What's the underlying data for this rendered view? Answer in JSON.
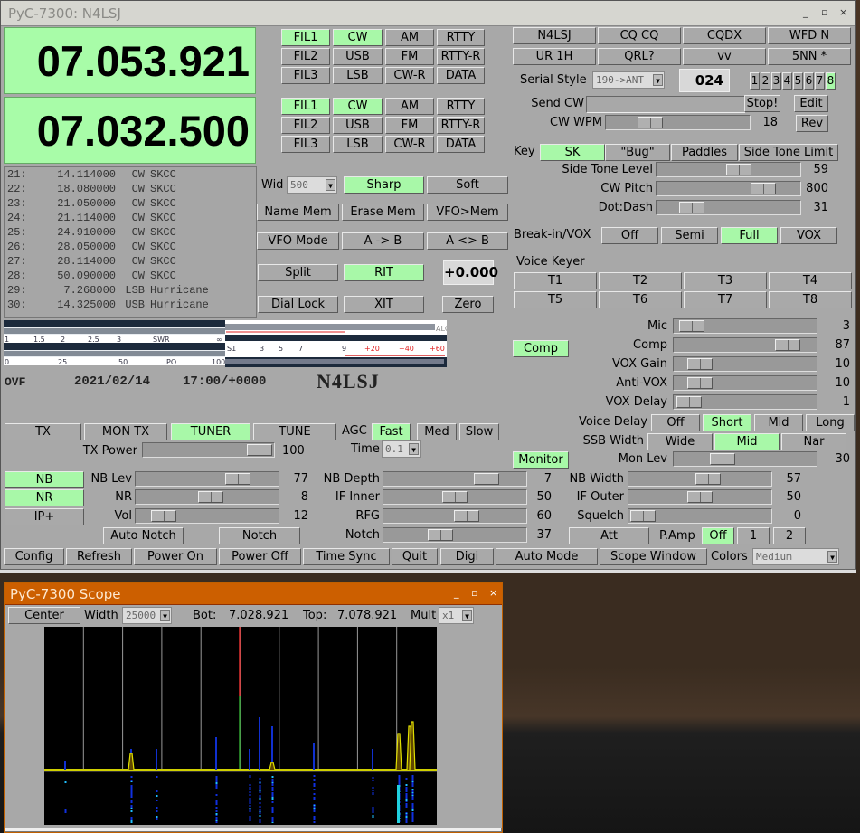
{
  "main_window": {
    "title": "PyC-7300: N4LSJ",
    "controls": {
      "minimize": "_",
      "maximize": "▫",
      "close": "×"
    },
    "vfo_a": "07.053.921",
    "vfo_b": "07.032.500",
    "mode_grid_a": [
      [
        "FIL1",
        "CW",
        "AM",
        "RTTY"
      ],
      [
        "FIL2",
        "USB",
        "FM",
        "RTTY-R"
      ],
      [
        "FIL3",
        "LSB",
        "CW-R",
        "DATA"
      ]
    ],
    "mode_grid_b": [
      [
        "FIL1",
        "CW",
        "AM",
        "RTTY"
      ],
      [
        "FIL2",
        "USB",
        "FM",
        "RTTY-R"
      ],
      [
        "FIL3",
        "LSB",
        "CW-R",
        "DATA"
      ]
    ],
    "active_modes": [
      "FIL1",
      "CW"
    ],
    "macros": [
      [
        "N4LSJ",
        "CQ CQ",
        "CQDX",
        "WFD N"
      ],
      [
        "UR 1H",
        "QRL?",
        "vv",
        "5NN *"
      ]
    ],
    "serial_style_label": "Serial Style",
    "serial_style_value": "190->ANT",
    "serial_number": "024",
    "memory_keys": [
      "1",
      "2",
      "3",
      "4",
      "5",
      "6",
      "7",
      "8"
    ],
    "memory_key_active": "8",
    "send_cw_label": "Send CW",
    "send_cw_value": "",
    "stop_label": "Stop!",
    "edit_label": "Edit",
    "cw_wpm_label": "CW WPM",
    "cw_wpm_value": "18",
    "cw_wpm_frac": 0.26,
    "rev_label": "Rev",
    "key_label": "Key",
    "key_options": [
      "SK",
      "\"Bug\"",
      "Paddles",
      "Side Tone Limit"
    ],
    "key_active": "SK",
    "side_tone_level": {
      "label": "Side Tone Level",
      "value": "59",
      "frac": 0.59
    },
    "cw_pitch": {
      "label": "CW Pitch",
      "value": "800",
      "frac": 0.8
    },
    "dot_dash": {
      "label": "Dot:Dash",
      "value": "31",
      "frac": 0.18
    },
    "breakin_label": "Break-in/VOX",
    "breakin_options": [
      "Off",
      "Semi",
      "Full",
      "VOX"
    ],
    "breakin_active": "Full",
    "voice_keyer_label": "Voice Keyer",
    "voice_keys": [
      "T1",
      "T2",
      "T3",
      "T4",
      "T5",
      "T6",
      "T7",
      "T8"
    ],
    "memory_list": [
      {
        "ch": "21:",
        "freq": "14.114000",
        "mode": "CW",
        "name": "SKCC"
      },
      {
        "ch": "22:",
        "freq": "18.080000",
        "mode": "CW",
        "name": "SKCC"
      },
      {
        "ch": "23:",
        "freq": "21.050000",
        "mode": "CW",
        "name": "SKCC"
      },
      {
        "ch": "24:",
        "freq": "21.114000",
        "mode": "CW",
        "name": "SKCC"
      },
      {
        "ch": "25:",
        "freq": "24.910000",
        "mode": "CW",
        "name": "SKCC"
      },
      {
        "ch": "26:",
        "freq": "28.050000",
        "mode": "CW",
        "name": "SKCC"
      },
      {
        "ch": "27:",
        "freq": "28.114000",
        "mode": "CW",
        "name": "SKCC"
      },
      {
        "ch": "28:",
        "freq": "50.090000",
        "mode": "CW",
        "name": "SKCC"
      },
      {
        "ch": "29:",
        "freq": "7.268000",
        "mode": "LSB",
        "name": "Hurricane"
      },
      {
        "ch": "30:",
        "freq": "14.325000",
        "mode": "USB",
        "name": "Hurricane"
      }
    ],
    "wid_label": "Wid",
    "wid_value": "500",
    "sharp_label": "Sharp",
    "soft_label": "Soft",
    "name_mem": "Name Mem",
    "erase_mem": "Erase Mem",
    "vfo_mem": "VFO>Mem",
    "vfo_mode": "VFO Mode",
    "a_to_b": "A -> B",
    "a_swap_b": "A <> B",
    "split": "Split",
    "rit": "RIT",
    "rit_offset": "+0.000",
    "dial_lock": "Dial Lock",
    "xit": "XIT",
    "zero": "Zero",
    "meter": {
      "swr_scale": [
        "1",
        "1.5",
        "2",
        "2.5",
        "3",
        "SWR",
        "∞"
      ],
      "po_scale": [
        "0",
        "25",
        "50",
        "PO",
        "100"
      ],
      "alc_label": "ALC",
      "s_scale": [
        "S1",
        "3",
        "5",
        "7",
        "9",
        "+20",
        "+40",
        "+60"
      ]
    },
    "status": {
      "ovf": "OVF",
      "date": "2021/02/14",
      "time": "17:00/+0000",
      "call": "N4LSJ"
    },
    "tx": "TX",
    "mon_tx": "MON TX",
    "tuner": "TUNER",
    "tune": "TUNE",
    "agc_label": "AGC",
    "agc_options": [
      "Fast",
      "Med",
      "Slow"
    ],
    "agc_active": "Fast",
    "time_label": "Time",
    "time_value": "0.1",
    "tx_power": {
      "label": "TX Power",
      "value": "100",
      "frac": 1.0
    },
    "mic": {
      "label": "Mic",
      "value": "3",
      "frac": 0.03
    },
    "comp_button": "Comp",
    "comp": {
      "label": "Comp",
      "value": "87",
      "frac": 0.87
    },
    "vox_gain": {
      "label": "VOX Gain",
      "value": "10",
      "frac": 0.1
    },
    "anti_vox": {
      "label": "Anti-VOX",
      "value": "10",
      "frac": 0.1
    },
    "vox_delay": {
      "label": "VOX Delay",
      "value": "1",
      "frac": 0.01
    },
    "voice_delay_label": "Voice Delay",
    "voice_delay_options": [
      "Off",
      "Short",
      "Mid",
      "Long"
    ],
    "voice_delay_active": "Short",
    "ssb_width_label": "SSB Width",
    "ssb_width_options": [
      "Wide",
      "Mid",
      "Nar"
    ],
    "ssb_width_active": "Mid",
    "monitor_button": "Monitor",
    "mon_lev": {
      "label": "Mon Lev",
      "value": "30",
      "frac": 0.3
    },
    "nb_button": "NB",
    "nr_button": "NR",
    "ipplus_button": "IP+",
    "nb_lev": {
      "label": "NB Lev",
      "value": "77",
      "frac": 0.77
    },
    "nr": {
      "label": "NR",
      "value": "8",
      "frac": 0.53
    },
    "vol": {
      "label": "Vol",
      "value": "12",
      "frac": 0.12
    },
    "auto_notch": "Auto Notch",
    "notch_button": "Notch",
    "nb_depth": {
      "label": "NB Depth",
      "value": "7",
      "frac": 0.78
    },
    "if_inner": {
      "label": "IF Inner",
      "value": "50",
      "frac": 0.5
    },
    "rfg": {
      "label": "RFG",
      "value": "60",
      "frac": 0.6
    },
    "notch": {
      "label": "Notch",
      "value": "37",
      "frac": 0.37
    },
    "nb_width": {
      "label": "NB Width",
      "value": "57",
      "frac": 0.57
    },
    "if_outer": {
      "label": "IF Outer",
      "value": "50",
      "frac": 0.5
    },
    "squelch": {
      "label": "Squelch",
      "value": "0",
      "frac": 0.0
    },
    "att": "Att",
    "pamp_label": "P.Amp",
    "pamp_options": [
      "Off",
      "1",
      "2"
    ],
    "pamp_active": "Off",
    "bottom_buttons": [
      "Config",
      "Refresh",
      "Power On",
      "Power Off",
      "Time Sync",
      "Quit",
      "Digi",
      "Auto Mode",
      "Scope Window"
    ],
    "colors_label": "Colors",
    "colors_value": "Medium"
  },
  "scope_window": {
    "title": "PyC-7300 Scope",
    "center": "Center",
    "width_label": "Width",
    "width_value": "25000",
    "bot_label": "Bot:",
    "bot_value": "7.028.921",
    "top_label": "Top:",
    "top_value": "7.078.921",
    "mult_label": "Mult",
    "mult_value": "x1"
  },
  "colors": {
    "active": "#a8f8a8",
    "panel": "#a8a8a8",
    "scope_title": "#cc5f00",
    "spectrum": "#ffff00",
    "waterfall": "#0000ff"
  }
}
